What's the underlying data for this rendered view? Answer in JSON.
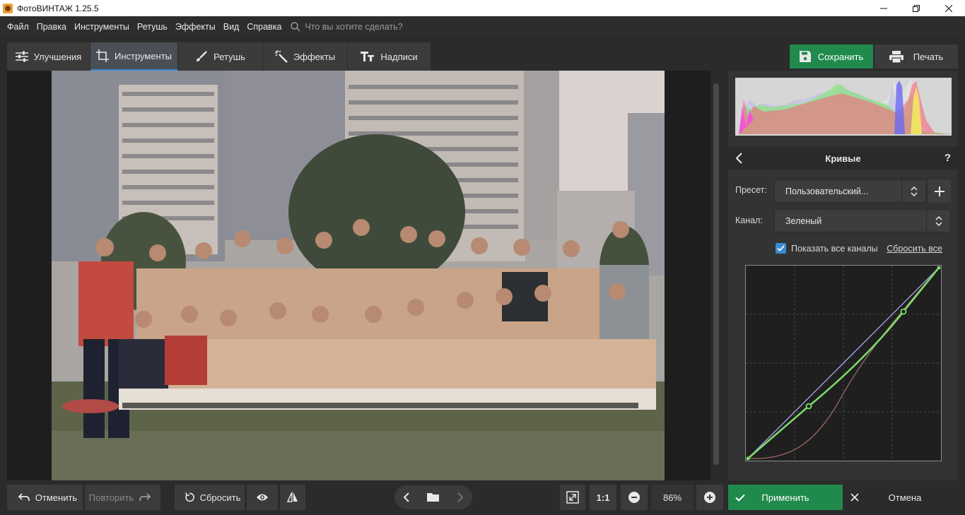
{
  "window": {
    "title": "ФотоВИНТАЖ 1.25.5",
    "controls": [
      "minimize-icon",
      "maximize-icon",
      "close-icon"
    ]
  },
  "menu": {
    "items": [
      "Файл",
      "Правка",
      "Инструменты",
      "Ретушь",
      "Эффекты",
      "Вид",
      "Справка"
    ],
    "search_placeholder": "Что вы хотите сделать?"
  },
  "tabs": [
    {
      "label": "Улучшения",
      "icon": "sliders-icon",
      "active": false
    },
    {
      "label": "Инструменты",
      "icon": "crop-icon",
      "active": true
    },
    {
      "label": "Ретушь",
      "icon": "brush-icon",
      "active": false
    },
    {
      "label": "Эффекты",
      "icon": "magic-wand-icon",
      "active": false
    },
    {
      "label": "Надписи",
      "icon": "text-icon",
      "active": false
    }
  ],
  "toolbar": {
    "save_label": "Сохранить",
    "print_label": "Печать"
  },
  "panel": {
    "title": "Кривые",
    "help": "?",
    "preset_label": "Пресет:",
    "preset_value": "Пользовательский...",
    "channel_label": "Канал:",
    "channel_value": "Зеленый",
    "show_all_channels_label": "Показать все каналы",
    "show_all_channels_checked": true,
    "reset_all_label": "Сбросить все"
  },
  "bottom": {
    "undo_label": "Отменить",
    "redo_label": "Повторить",
    "reset_label": "Сбросить",
    "fit_label": "1:1",
    "zoom_value": "86%",
    "apply_label": "Применить",
    "cancel_label": "Отмена"
  },
  "colors": {
    "accent_green": "#1f8a4c",
    "accent_blue": "#3a8bd3",
    "curve_green": "#7ddc6a",
    "curve_reference": "#9a9ae0",
    "curve_red": "#9a6a60"
  }
}
